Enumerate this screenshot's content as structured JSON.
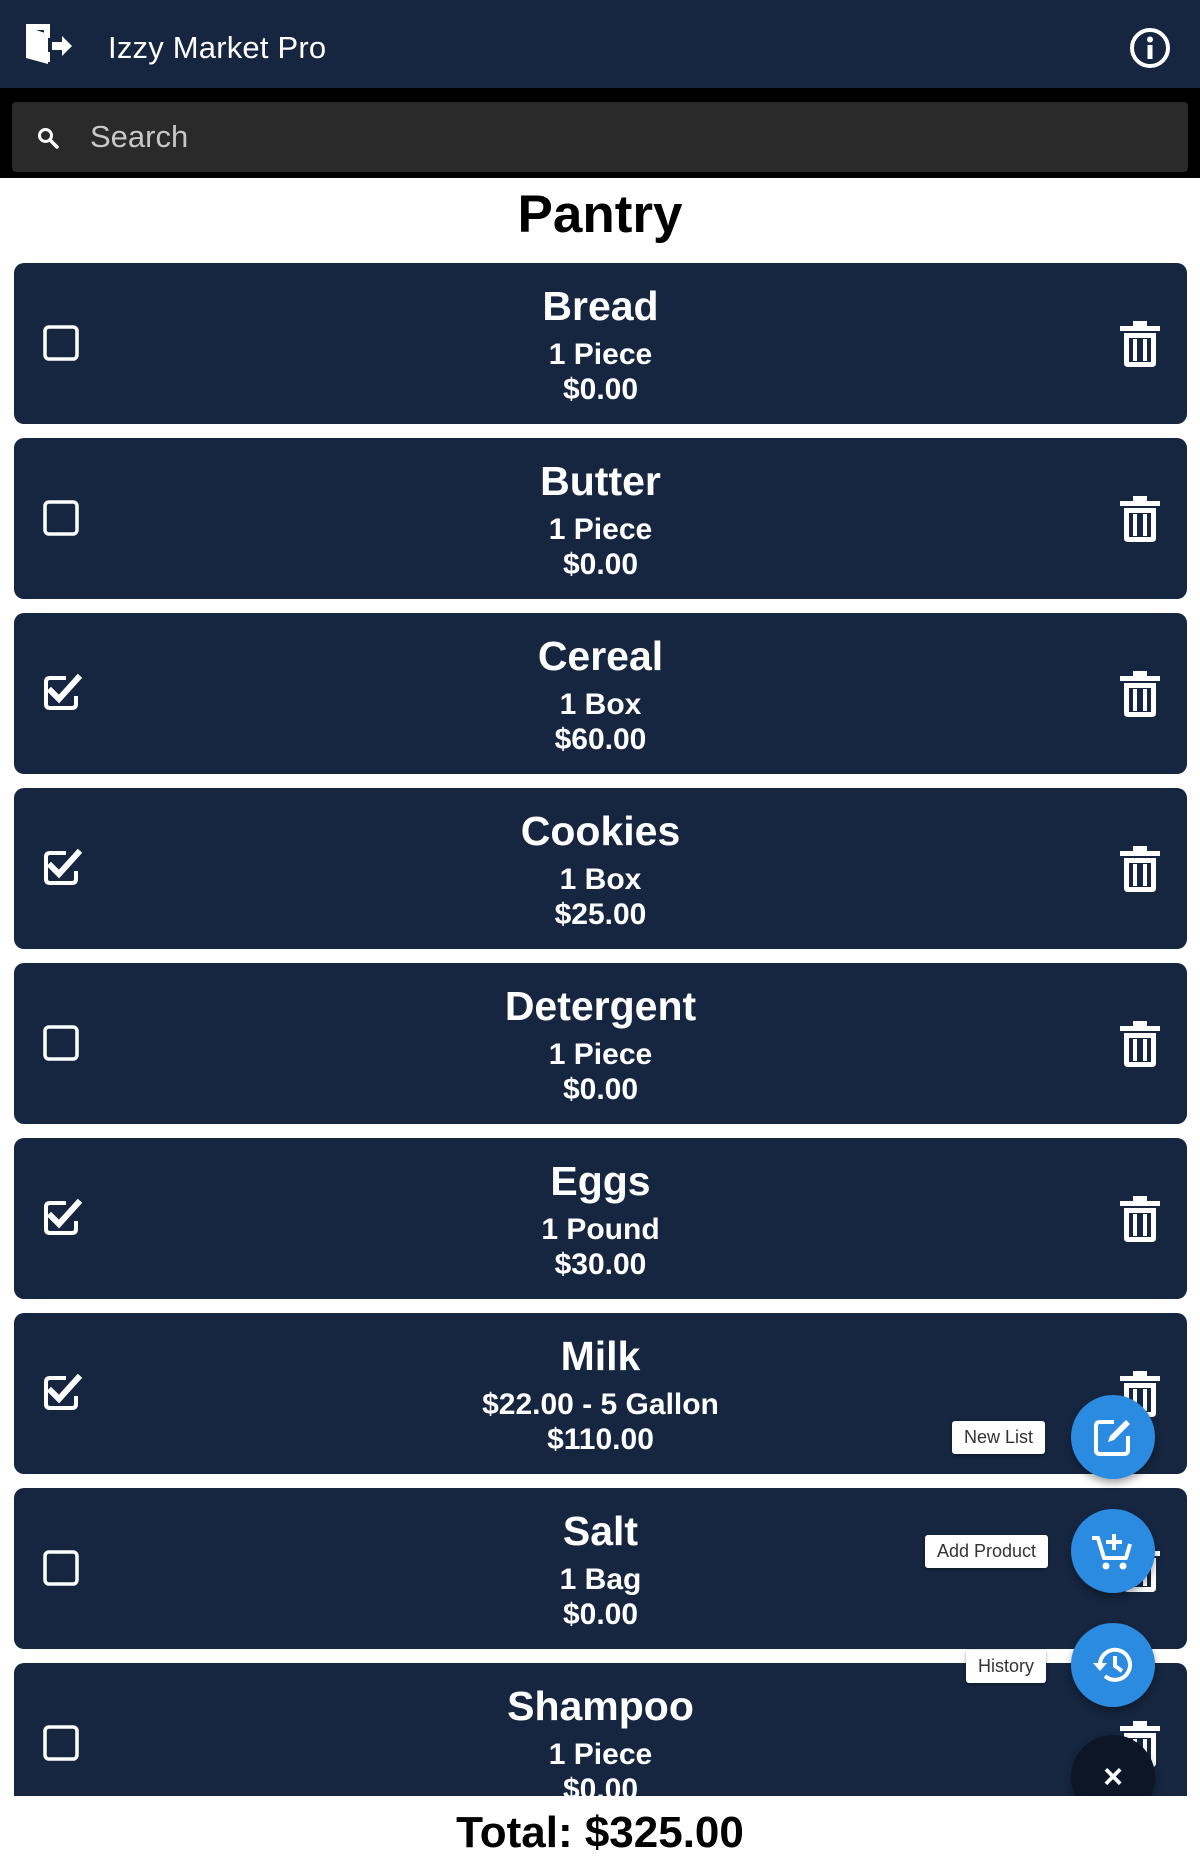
{
  "app": {
    "title": "Izzy Market Pro",
    "icons": {
      "logout": "logout-icon",
      "info": "info-icon"
    },
    "colors": {
      "bar": "#162640",
      "card": "#162640",
      "fab": "#2a8be0"
    }
  },
  "search": {
    "placeholder": "Search",
    "value": ""
  },
  "list_title": "Pantry",
  "items": [
    {
      "name": "Bread",
      "qty": "1 Piece",
      "price": "$0.00",
      "checked": false
    },
    {
      "name": "Butter",
      "qty": "1 Piece",
      "price": "$0.00",
      "checked": false
    },
    {
      "name": "Cereal",
      "qty": "1 Box",
      "price": "$60.00",
      "checked": true
    },
    {
      "name": "Cookies",
      "qty": "1 Box",
      "price": "$25.00",
      "checked": true
    },
    {
      "name": "Detergent",
      "qty": "1 Piece",
      "price": "$0.00",
      "checked": false
    },
    {
      "name": "Eggs",
      "qty": "1 Pound",
      "price": "$30.00",
      "checked": true
    },
    {
      "name": "Milk",
      "qty": "$22.00 - 5 Gallon",
      "price": "$110.00",
      "checked": true
    },
    {
      "name": "Salt",
      "qty": "1 Bag",
      "price": "$0.00",
      "checked": false
    },
    {
      "name": "Shampoo",
      "qty": "1 Piece",
      "price": "$0.00",
      "checked": false
    }
  ],
  "fab_menu": {
    "new_list": "New List",
    "add_product": "Add Product",
    "history": "History",
    "close": "×"
  },
  "total": "Total: $325.00"
}
